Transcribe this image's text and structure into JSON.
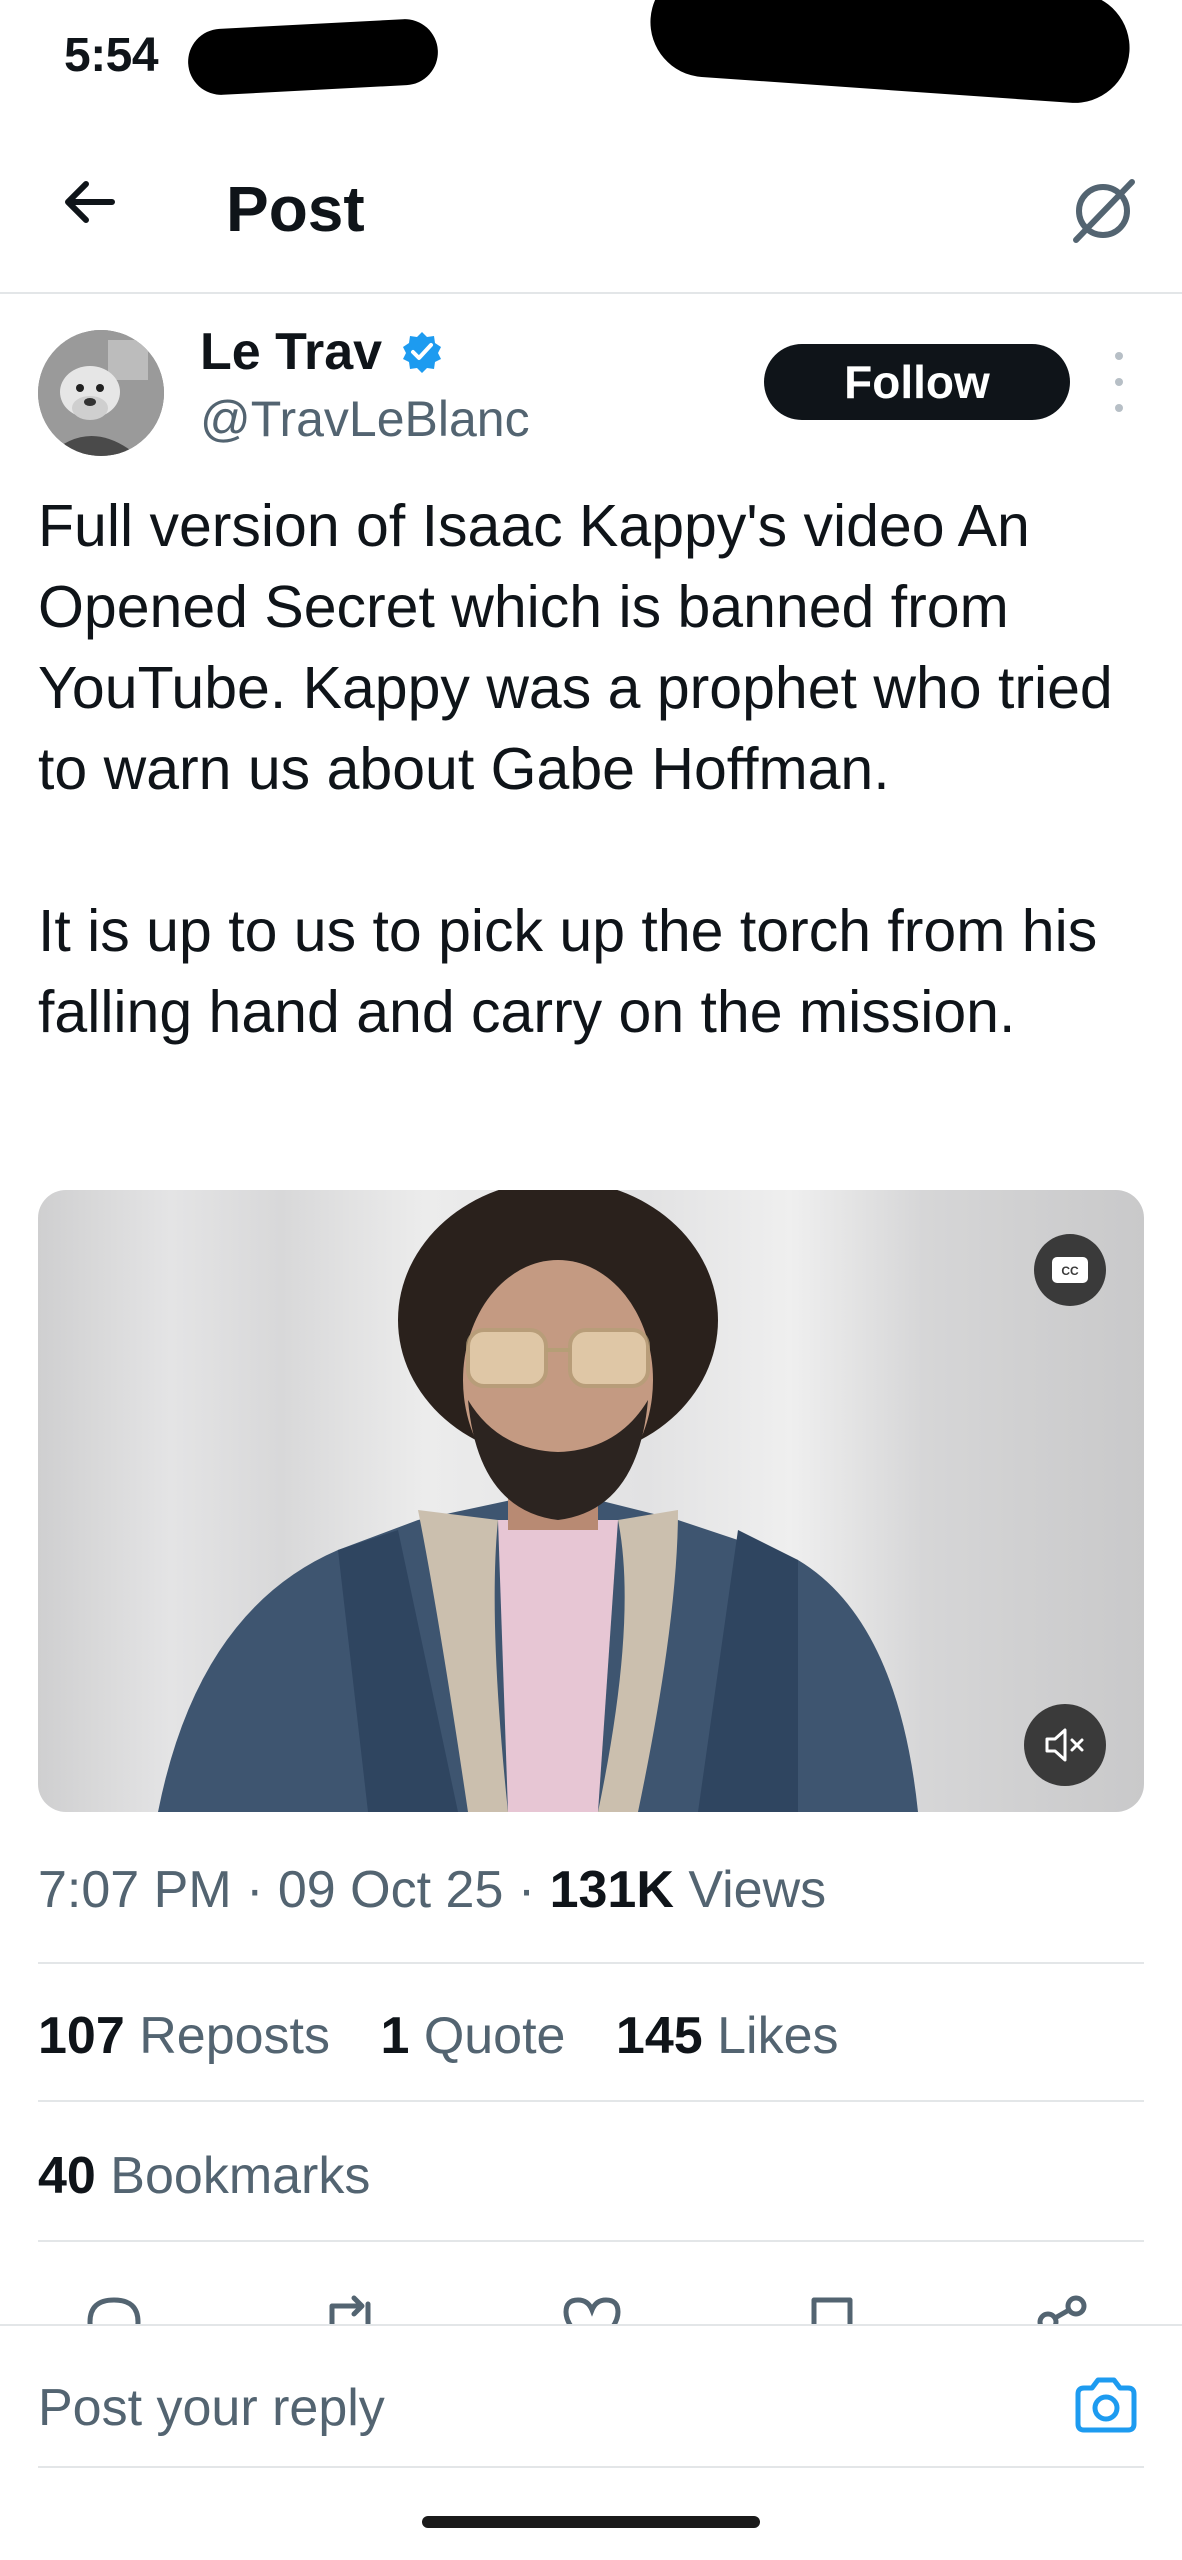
{
  "status_bar": {
    "time": "5:54"
  },
  "header": {
    "title": "Post",
    "back_icon": "arrow-left-icon",
    "grok_icon": "grok-icon"
  },
  "author": {
    "display_name": "Le Trav",
    "handle": "@TravLeBlanc",
    "verified": true,
    "follow_label": "Follow"
  },
  "tweet": {
    "paragraphs": [
      "Full version of Isaac Kappy's video An Opened Secret which is banned from YouTube. Kappy was a prophet who tried to warn us about Gabe Hoffman.",
      "It is up to us to pick up the torch from his falling hand and carry on the mission."
    ],
    "time": "7:07 PM",
    "date": "09 Oct 25",
    "views_count": "131K",
    "views_label": "Views"
  },
  "video": {
    "cc_label": "CC",
    "muted": true
  },
  "stats": {
    "reposts_count": "107",
    "reposts_label": "Reposts",
    "quote_count": "1",
    "quote_label": "Quote",
    "likes_count": "145",
    "likes_label": "Likes",
    "bookmarks_count": "40",
    "bookmarks_label": "Bookmarks"
  },
  "actions": [
    "reply-icon",
    "repost-icon",
    "like-icon",
    "bookmark-icon",
    "share-icon"
  ],
  "reply": {
    "placeholder": "Post your reply"
  },
  "colors": {
    "text": "#0f1419",
    "secondary": "#536471",
    "accent": "#1d9bf0",
    "divider": "#e3e6e8"
  }
}
